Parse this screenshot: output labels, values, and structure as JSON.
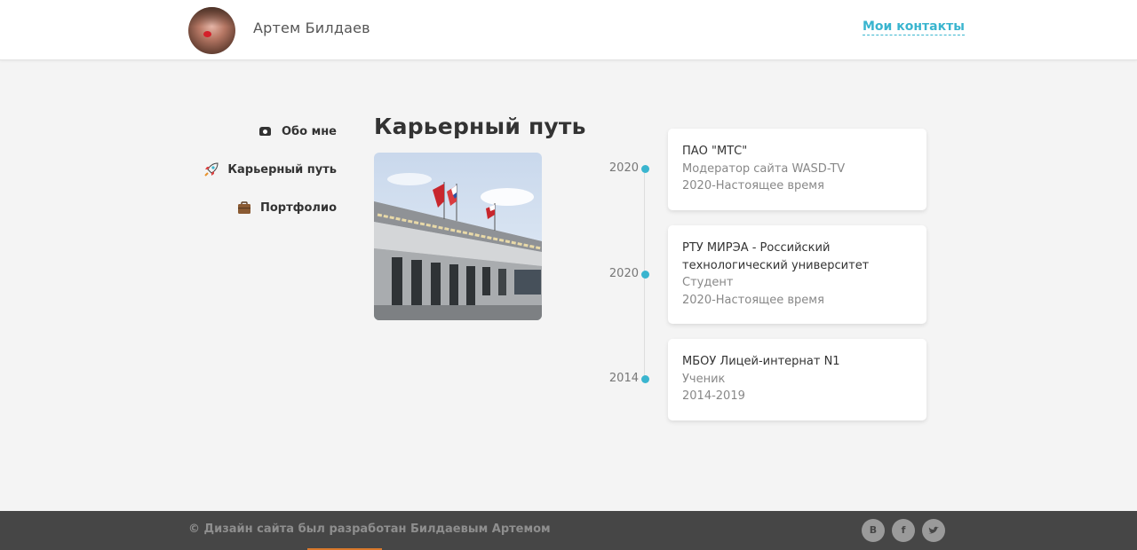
{
  "header": {
    "name": "Артем Билдаев",
    "contacts_link": "Мои контакты"
  },
  "nav": {
    "items": [
      {
        "label": "Обо мне",
        "icon": "phone-icon"
      },
      {
        "label": "Карьерный путь",
        "icon": "rocket-icon"
      },
      {
        "label": "Портфолио",
        "icon": "briefcase-icon"
      }
    ]
  },
  "main": {
    "title": "Карьерный путь"
  },
  "timeline": [
    {
      "year": "2020",
      "org": "ПАО \"МТС\"",
      "role": "Модератор сайта WASD-TV",
      "period": "2020-Настоящее время"
    },
    {
      "year": "2020",
      "org": "РТУ МИРЭА - Российский технологический университет",
      "role": "Студент",
      "period": "2020-Настоящее время"
    },
    {
      "year": "2014",
      "org": "МБОУ Лицей-интернат N1",
      "role": "Ученик",
      "period": "2014-2019"
    }
  ],
  "footer": {
    "copyright": "© Дизайн сайта был разработан Билдаевым Артемом",
    "social": [
      {
        "name": "vk-icon",
        "glyph": "B"
      },
      {
        "name": "facebook-icon",
        "glyph": "f"
      },
      {
        "name": "twitter-icon",
        "glyph": "🐦"
      }
    ]
  },
  "colors": {
    "accent": "#3ab5cf",
    "footer_bg": "#464646",
    "page_bg": "#f4f4f4"
  }
}
